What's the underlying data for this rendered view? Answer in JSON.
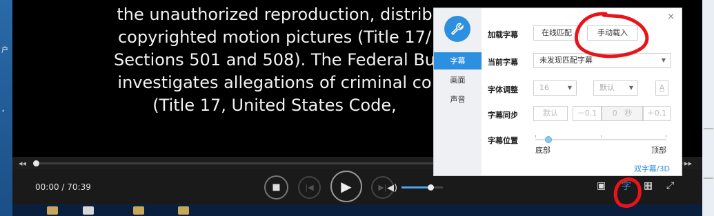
{
  "desktop": {
    "left_labels": [
      "户",
      "，"
    ]
  },
  "subtitle_lines": [
    "the unauthorized reproduction, distrib",
    "copyrighted motion pictures (Title 17/",
    "Sections 501 and 508).  The Federal Bu",
    "investigates allegations of criminal co",
    "(Title 17, United States Code,"
  ],
  "playback": {
    "time": "00:00 / 70:39",
    "progress": 0.0,
    "volume": 0.7
  },
  "panel": {
    "tabs": [
      "字幕",
      "画面",
      "声音"
    ],
    "active_tab": "字幕",
    "load_subtitle": {
      "label": "加载字幕",
      "online_match": "在线匹配",
      "manual_load": "手动载入"
    },
    "current_subtitle": {
      "label": "当前字幕",
      "value": "未发现匹配字幕"
    },
    "font_adjust": {
      "label": "字体调整",
      "size": "16",
      "style": "默认",
      "color_btn": "A"
    },
    "subtitle_sync": {
      "label": "字幕同步",
      "default_btn": "默认",
      "minus": "－0.1",
      "value": "0",
      "unit": "秒",
      "plus": "＋0.1"
    },
    "subtitle_position": {
      "label": "字幕位置",
      "min_label": "底部",
      "max_label": "顶部",
      "level": 0.1
    },
    "dual_subtitle_link": "双字幕/3D",
    "close": "×"
  },
  "controls": {
    "subtitle_btn": "字"
  },
  "colors": {
    "accent": "#2d8fe0",
    "annotation": "#e8141a"
  }
}
